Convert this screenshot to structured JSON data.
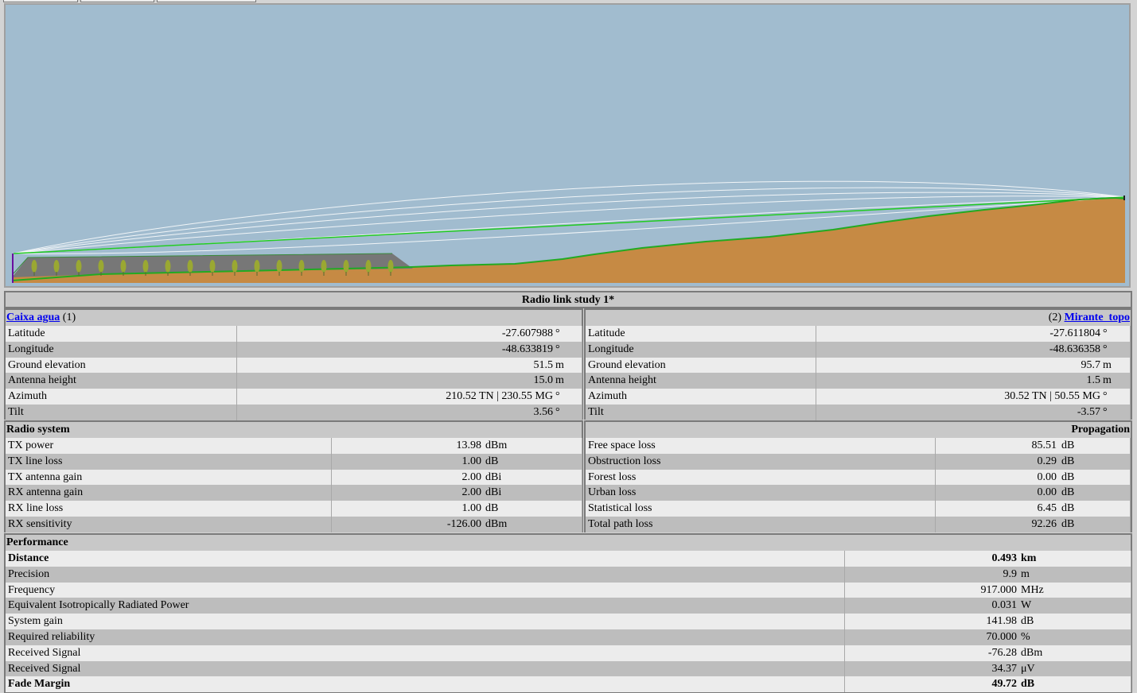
{
  "report": {
    "title": "Radio link study 1*",
    "unit1": {
      "name": "Caixa agua",
      "index": "(1)",
      "rows": [
        {
          "label": "Latitude",
          "value": "-27.607988",
          "unit": "°"
        },
        {
          "label": "Longitude",
          "value": "-48.633819",
          "unit": "°"
        },
        {
          "label": "Ground elevation",
          "value": "51.5",
          "unit": "m"
        },
        {
          "label": "Antenna height",
          "value": "15.0",
          "unit": "m"
        },
        {
          "label": "Azimuth",
          "value": "210.52 TN | 230.55 MG",
          "unit": "°"
        },
        {
          "label": "Tilt",
          "value": "3.56",
          "unit": "°"
        }
      ]
    },
    "unit2": {
      "name": "Mirante_topo",
      "index": "(2)",
      "rows": [
        {
          "label": "Latitude",
          "value": "-27.611804",
          "unit": "°"
        },
        {
          "label": "Longitude",
          "value": "-48.636358",
          "unit": "°"
        },
        {
          "label": "Ground elevation",
          "value": "95.7",
          "unit": "m"
        },
        {
          "label": "Antenna height",
          "value": "1.5",
          "unit": "m"
        },
        {
          "label": "Azimuth",
          "value": "30.52 TN | 50.55 MG",
          "unit": "°"
        },
        {
          "label": "Tilt",
          "value": "-3.57",
          "unit": "°"
        }
      ]
    },
    "radio": {
      "header": "Radio system",
      "rows": [
        {
          "label": "TX power",
          "value": "13.98",
          "unit": "dBm"
        },
        {
          "label": "TX line loss",
          "value": "1.00",
          "unit": "dB"
        },
        {
          "label": "TX antenna gain",
          "value": "2.00",
          "unit": "dBi"
        },
        {
          "label": "RX antenna gain",
          "value": "2.00",
          "unit": "dBi"
        },
        {
          "label": "RX line loss",
          "value": "1.00",
          "unit": "dB"
        },
        {
          "label": "RX sensitivity",
          "value": "-126.00",
          "unit": "dBm"
        }
      ]
    },
    "propagation": {
      "header": "Propagation",
      "rows": [
        {
          "label": "Free space loss",
          "value": "85.51",
          "unit": "dB"
        },
        {
          "label": "Obstruction loss",
          "value": "0.29",
          "unit": "dB"
        },
        {
          "label": "Forest loss",
          "value": "0.00",
          "unit": "dB"
        },
        {
          "label": "Urban loss",
          "value": "0.00",
          "unit": "dB"
        },
        {
          "label": "Statistical loss",
          "value": "6.45",
          "unit": "dB"
        },
        {
          "label": "Total path loss",
          "value": "92.26",
          "unit": "dB"
        }
      ]
    },
    "performance": {
      "header": "Performance",
      "rows": [
        {
          "label": "Distance",
          "value": "0.493",
          "unit": "km",
          "bold": true
        },
        {
          "label": "Precision",
          "value": "9.9",
          "unit": "m"
        },
        {
          "label": "Frequency",
          "value": "917.000",
          "unit": "MHz"
        },
        {
          "label": "Equivalent Isotropically Radiated Power",
          "value": "0.031",
          "unit": "W"
        },
        {
          "label": "System gain",
          "value": "141.98",
          "unit": "dB"
        },
        {
          "label": "Required reliability",
          "value": "70.000",
          "unit": "%"
        },
        {
          "label": "Received Signal",
          "value": "-76.28",
          "unit": "dBm"
        },
        {
          "label": "Received Signal",
          "value": "34.37",
          "unit": "μV"
        },
        {
          "label": "Fade Margin",
          "value": "49.72",
          "unit": "dB",
          "bold": true
        }
      ]
    }
  },
  "colors": {
    "sky": "#a1bccf",
    "terrain": "#c68a44",
    "link": "#22cc22",
    "forest": "#777777",
    "tree": "#9aa832"
  }
}
